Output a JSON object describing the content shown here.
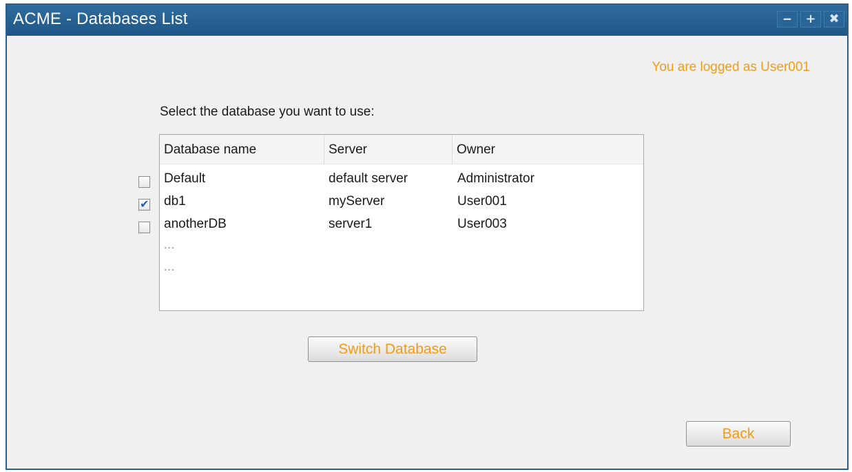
{
  "window": {
    "title": "ACME - Databases List",
    "controls": {
      "minimize": "‒",
      "maximize": "+",
      "close": "✖"
    }
  },
  "header": {
    "logged_as": "You are logged as User001"
  },
  "prompt": "Select the database you want to use:",
  "table": {
    "columns": [
      "Database name",
      "Server",
      "Owner"
    ],
    "rows": [
      {
        "name": "Default",
        "server": "default server",
        "owner": "Administrator",
        "checked": false
      },
      {
        "name": "db1",
        "server": "myServer",
        "owner": "User001",
        "checked": true
      },
      {
        "name": "anotherDB",
        "server": "server1",
        "owner": "User003",
        "checked": false
      }
    ],
    "more_rows": [
      "...",
      "..."
    ]
  },
  "buttons": {
    "switch_database": "Switch Database",
    "back": "Back"
  },
  "colors": {
    "accent": "#f39c12",
    "titlebar": "#1e5786"
  }
}
